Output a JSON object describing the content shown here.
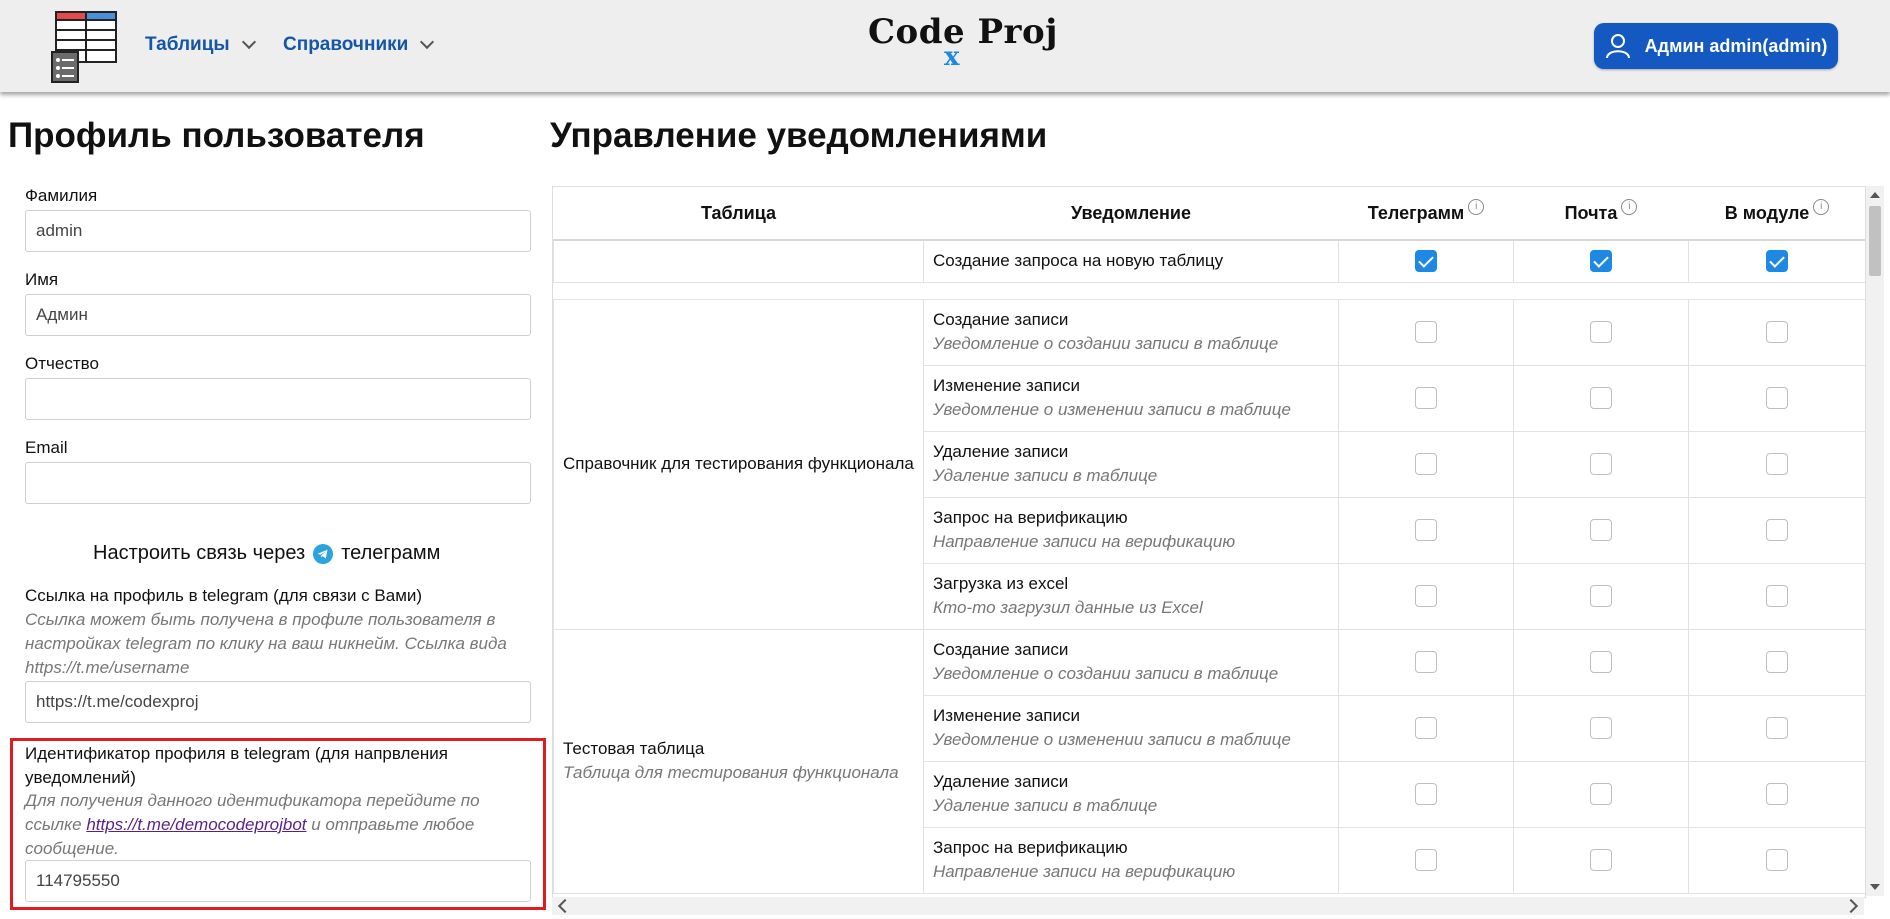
{
  "header": {
    "nav": [
      {
        "label": "Таблицы"
      },
      {
        "label": "Справочники"
      }
    ],
    "brand": "Code Proj",
    "brand_x": "x",
    "user_label": "Админ admin(admin)"
  },
  "profile": {
    "title": "Профиль пользователя",
    "fields": {
      "last_name": {
        "label": "Фамилия",
        "value": "admin"
      },
      "first_name": {
        "label": "Имя",
        "value": "Админ"
      },
      "middle_name": {
        "label": "Отчество",
        "value": ""
      },
      "email": {
        "label": "Email",
        "value": ""
      }
    },
    "telegram_heading_pre": "Настроить связь через",
    "telegram_heading_post": "телеграмм",
    "tg_link": {
      "label": "Ссылка на профиль в telegram (для связи с Вами)",
      "hint": "Ссылка может быть получена в профиле пользователя в настройках telegram по клику на ваш никнейм. Ссылка вида https://t.me/username",
      "value": "https://t.me/codexproj"
    },
    "tg_id": {
      "label": "Идентификатор профиля в telegram (для напрвления уведомлений)",
      "hint_pre": "Для получения данного идентификатора перейдите по ссылке",
      "hint_link": "https://t.me/democodeprojbot",
      "hint_post": "и отправьте любое сообщение.",
      "value": "114795550"
    }
  },
  "notifications": {
    "title": "Управление уведомлениями",
    "columns": {
      "table": "Таблица",
      "notification": "Уведомление",
      "telegram": "Телеграмм",
      "mail": "Почта",
      "module": "В модуле"
    },
    "top_row": {
      "title": "Создание запроса на новую таблицу",
      "telegram": true,
      "mail": true,
      "module": true
    },
    "groups": [
      {
        "table": "Справочник для тестирования функционала",
        "table_desc": "",
        "rows": [
          {
            "title": "Создание записи",
            "desc": "Уведомление о создании записи в таблице"
          },
          {
            "title": "Изменение записи",
            "desc": "Уведомление о изменении записи в таблице"
          },
          {
            "title": "Удаление записи",
            "desc": "Удаление записи в таблице"
          },
          {
            "title": "Запрос на верификацию",
            "desc": "Направление записи на верификацию"
          },
          {
            "title": "Загрузка из excel",
            "desc": "Кто-то загрузил данные из Excel"
          }
        ]
      },
      {
        "table": "Тестовая таблица",
        "table_desc": "Таблица для тестирования функционала",
        "rows": [
          {
            "title": "Создание записи",
            "desc": "Уведомление о создании записи в таблице"
          },
          {
            "title": "Изменение записи",
            "desc": "Уведомление о изменении записи в таблице"
          },
          {
            "title": "Удаление записи",
            "desc": "Удаление записи в таблице"
          },
          {
            "title": "Запрос на верификацию",
            "desc": "Направление записи на верификацию"
          }
        ]
      }
    ]
  },
  "colors": {
    "accent": "#1e88e5",
    "user_button": "#1458c2",
    "nav": "#1556a6",
    "highlight": "#e11b22"
  }
}
